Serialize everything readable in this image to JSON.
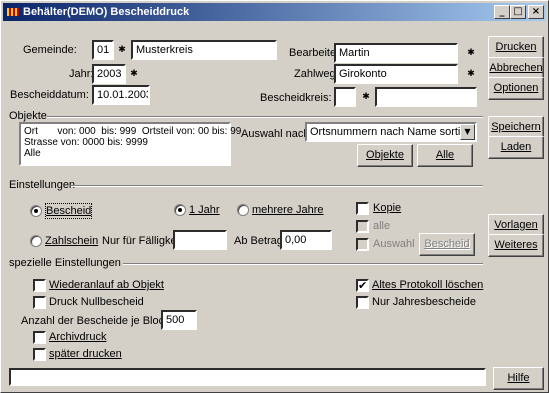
{
  "window": {
    "title": "Behälter(DEMO)  Bescheiddruck"
  },
  "titlebar_buttons": {
    "minimize": "_",
    "maximize": "□",
    "close": "×"
  },
  "header": {
    "gemeinde_label": "Gemeinde:",
    "gemeinde_code": "01",
    "gemeinde_name": "Musterkreis",
    "jahr_label": "Jahr:",
    "jahr_value": "2003",
    "bescheiddatum_label": "Bescheiddatum:",
    "bescheiddatum_value": "10.01.2003",
    "bearbeiter_label": "Bearbeiter:",
    "bearbeiter_value": "Martin",
    "zahlweg_label": "Zahlweg:",
    "zahlweg_value": "Girokonto",
    "bescheidkreis_label": "Bescheidkreis:",
    "bescheidkreis_code": "",
    "bescheidkreis_name": ""
  },
  "objekte": {
    "group_label": "Objekte",
    "lines": [
      "Ort       von: 000  bis: 999  Ortsteil von: 00 bis: 99",
      "Strasse von: 0000 bis: 9999",
      "Alle"
    ],
    "auswahl_label": "Auswahl nach:",
    "auswahl_value": "Ortsnummern nach Name sortiert",
    "objekte_button": "Objekte",
    "alle_button": "Alle"
  },
  "einstellungen": {
    "group_label": "Einstellungen",
    "bescheid_label": "Bescheid",
    "ein_jahr_label": "1 Jahr",
    "mehrere_jahre_label": "mehrere Jahre",
    "zahlschein_label": "Zahlschein",
    "nur_faelligkeit_label": "Nur für Fälligkeit:",
    "nur_faelligkeit_value": "",
    "ab_betrag_label": "Ab Betrag:",
    "ab_betrag_value": "0,00",
    "kopie_label": "Kopie",
    "alle_label": "alle",
    "auswahl_cb_label": "Auswahl",
    "bescheid_button": "Bescheid"
  },
  "spezielle": {
    "group_label": "spezielle Einstellungen",
    "wiederanlauf_label": "Wiederanlauf ab Objekt",
    "druck_null_label": "Druck Nullbescheid",
    "anzahl_label": "Anzahl der Bescheide je Block:",
    "anzahl_value": "500",
    "archivdruck_label": "Archivdruck",
    "spaeter_label": "später drucken",
    "altes_protokoll_label": "Altes Protokoll löschen",
    "nur_jahres_label": "Nur Jahresbescheide"
  },
  "buttons": {
    "drucken": "Drucken",
    "abbrechen": "Abbrechen",
    "optionen": "Optionen",
    "speichern": "Speichern",
    "laden": "Laden",
    "vorlagen": "Vorlagen",
    "weiteres": "Weiteres",
    "hilfe": "Hilfe"
  },
  "status": {
    "text": ""
  },
  "checks": {
    "checked_mark": "✔"
  },
  "icons": {
    "dropdown_arrow": "▼",
    "spin_arrow": "✱"
  }
}
